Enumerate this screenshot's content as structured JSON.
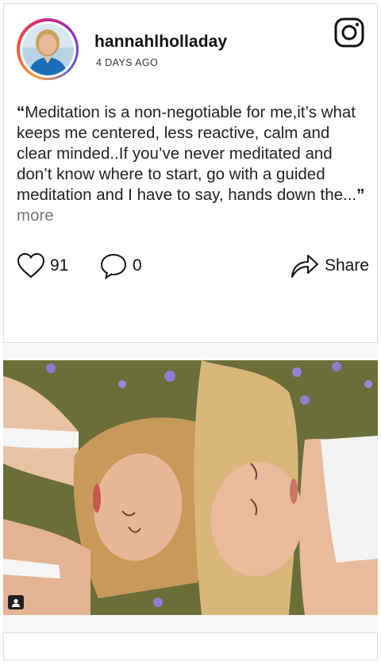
{
  "post": {
    "username": "hannahlholladay",
    "timestamp": "4 DAYS AGO",
    "caption_open_quote": "“",
    "caption_text": "Meditation is a non-negotiable for me,it’s what keeps me centered, less reactive, calm and clear minded..If you’ve never meditated and don’t know where to start, go with a guided meditation and I have to say, hands down the...",
    "caption_close_quote": "”",
    "more_label": "more",
    "likes": "91",
    "comments": "0",
    "share_label": "Share"
  },
  "icons": {
    "brand": "instagram-icon",
    "like": "heart-icon",
    "comment": "comment-icon",
    "share": "share-arrow-icon",
    "tag": "user-tag-icon"
  },
  "colors": {
    "avatar_ring": [
      "#f9a13a",
      "#d62976",
      "#962fbf",
      "#4f5bd5"
    ],
    "more_text": "#777777"
  }
}
